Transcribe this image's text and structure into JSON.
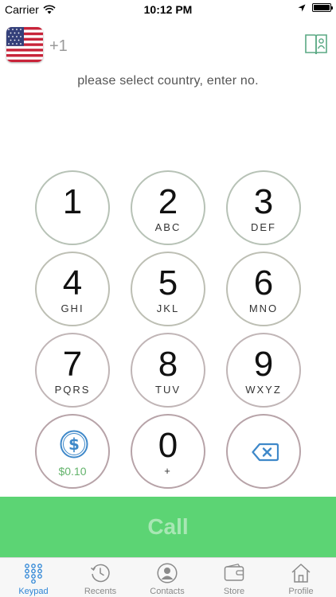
{
  "status_bar": {
    "carrier": "Carrier",
    "time": "10:12 PM"
  },
  "header": {
    "flag_icon": "us-flag-icon",
    "dial_code": "+1",
    "contacts_icon": "contacts-book-icon"
  },
  "prompt": "please select country, enter no.",
  "keypad": {
    "keys": [
      {
        "digit": "1",
        "letters": ""
      },
      {
        "digit": "2",
        "letters": "ABC"
      },
      {
        "digit": "3",
        "letters": "DEF"
      },
      {
        "digit": "4",
        "letters": "GHI"
      },
      {
        "digit": "5",
        "letters": "JKL"
      },
      {
        "digit": "6",
        "letters": "MNO"
      },
      {
        "digit": "7",
        "letters": "PQRS"
      },
      {
        "digit": "8",
        "letters": "TUV"
      },
      {
        "digit": "9",
        "letters": "WXYZ"
      },
      {
        "digit": "0",
        "letters": "+"
      }
    ],
    "credit": "$0.10",
    "credit_icon": "dollar-coin-icon",
    "delete_icon": "backspace-icon"
  },
  "call": {
    "label": "Call"
  },
  "tabs": [
    {
      "label": "Keypad",
      "icon": "keypad-icon",
      "active": true
    },
    {
      "label": "Recents",
      "icon": "clock-icon",
      "active": false
    },
    {
      "label": "Contacts",
      "icon": "person-icon",
      "active": false
    },
    {
      "label": "Store",
      "icon": "wallet-icon",
      "active": false
    },
    {
      "label": "Profile",
      "icon": "house-icon",
      "active": false
    }
  ],
  "colors": {
    "call_bar": "#5cd474",
    "call_label": "#a8e7b4",
    "accent": "#2f86d6",
    "credit": "#63b36b"
  }
}
